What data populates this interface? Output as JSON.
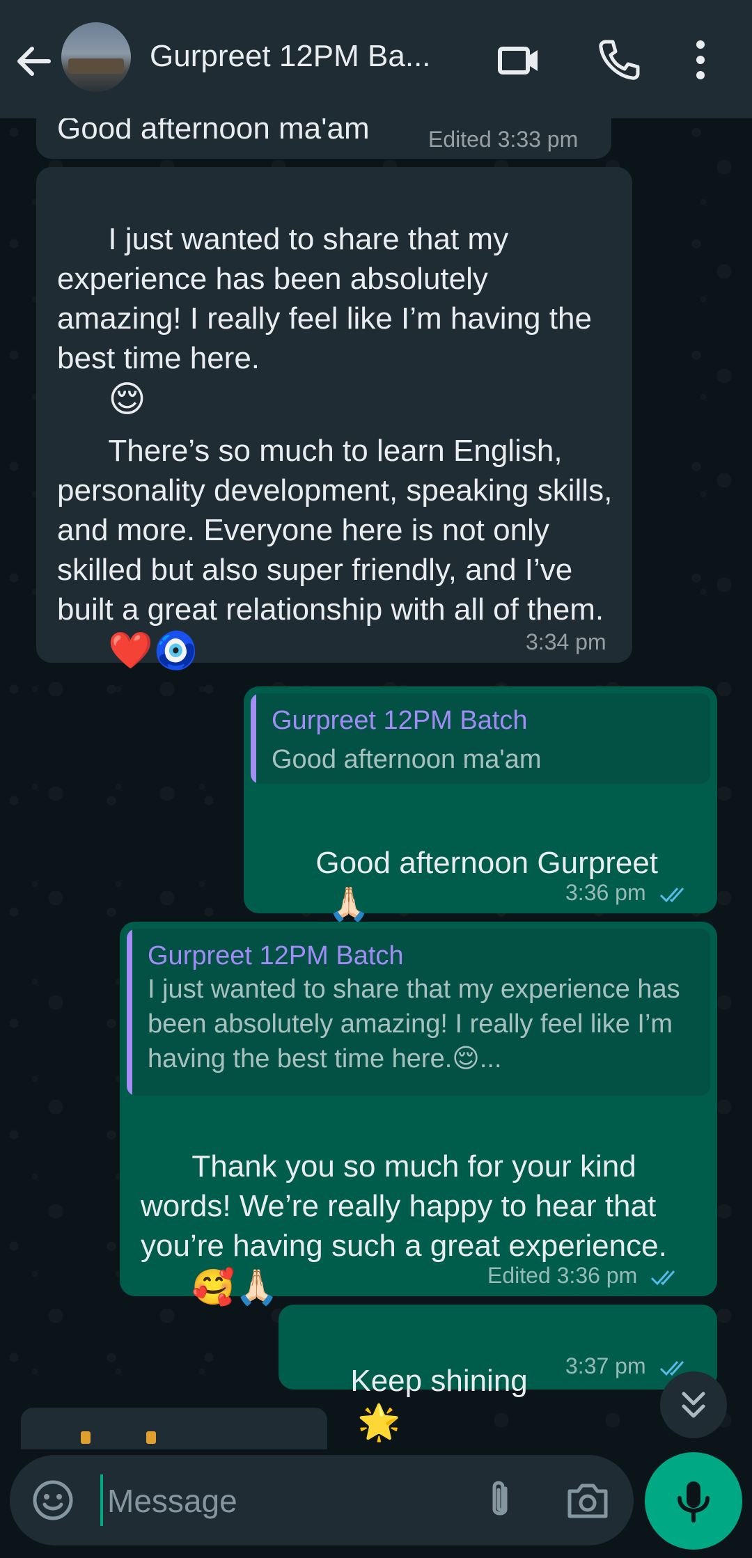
{
  "header": {
    "title": "Gurpreet 12PM Ba...",
    "back_icon": "arrow-left-icon",
    "video_icon": "video-camera-icon",
    "call_icon": "phone-icon",
    "menu_icon": "more-vertical-icon"
  },
  "messages": [
    {
      "direction": "incoming",
      "text": "Good afternoon ma'am",
      "time": "Edited 3:33 pm"
    },
    {
      "direction": "incoming",
      "text_part1": "I just wanted to share that my experience has been absolutely amazing! I really feel like I’m having the best time here.",
      "emoji_part1": "😌",
      "text_part2": "There’s so much to learn English, personality development, speaking skills, and more. Everyone here is not only skilled but also super friendly, and I’ve built a great relationship with all of them.",
      "emoji_part2": "❤️🧿",
      "time": "3:34 pm"
    },
    {
      "direction": "outgoing",
      "quote_name": "Gurpreet 12PM Batch",
      "quote_text": "Good afternoon ma'am",
      "text": "Good afternoon Gurpreet",
      "emoji": "🙏🏻",
      "time": "3:36 pm"
    },
    {
      "direction": "outgoing",
      "quote_name": "Gurpreet 12PM Batch",
      "quote_text": "I just wanted to share that my experience has been absolutely amazing! I really feel like I’m having the best time here.😌...",
      "text": "Thank you so much for your kind words! We’re really happy to hear that you’re having such a great experience.",
      "emoji": "🥰🙏🏻",
      "time": "Edited 3:36 pm"
    },
    {
      "direction": "outgoing",
      "text": "Keep shining",
      "emoji": "🌟",
      "time": "3:37 pm"
    }
  ],
  "composer": {
    "placeholder": "Message",
    "emoji_icon": "smiley-icon",
    "attach_icon": "paperclip-icon",
    "camera_icon": "camera-icon",
    "mic_icon": "microphone-icon"
  },
  "scroll_button_icon": "double-chevron-down-icon",
  "colors": {
    "header_bg": "#1f2c34",
    "chat_bg": "#0b1418",
    "incoming_bubble": "#1f2c34",
    "outgoing_bubble": "#005c4b",
    "accent": "#00a884",
    "quote_name": "#a08cf4",
    "read_ticks": "#53bdeb"
  }
}
